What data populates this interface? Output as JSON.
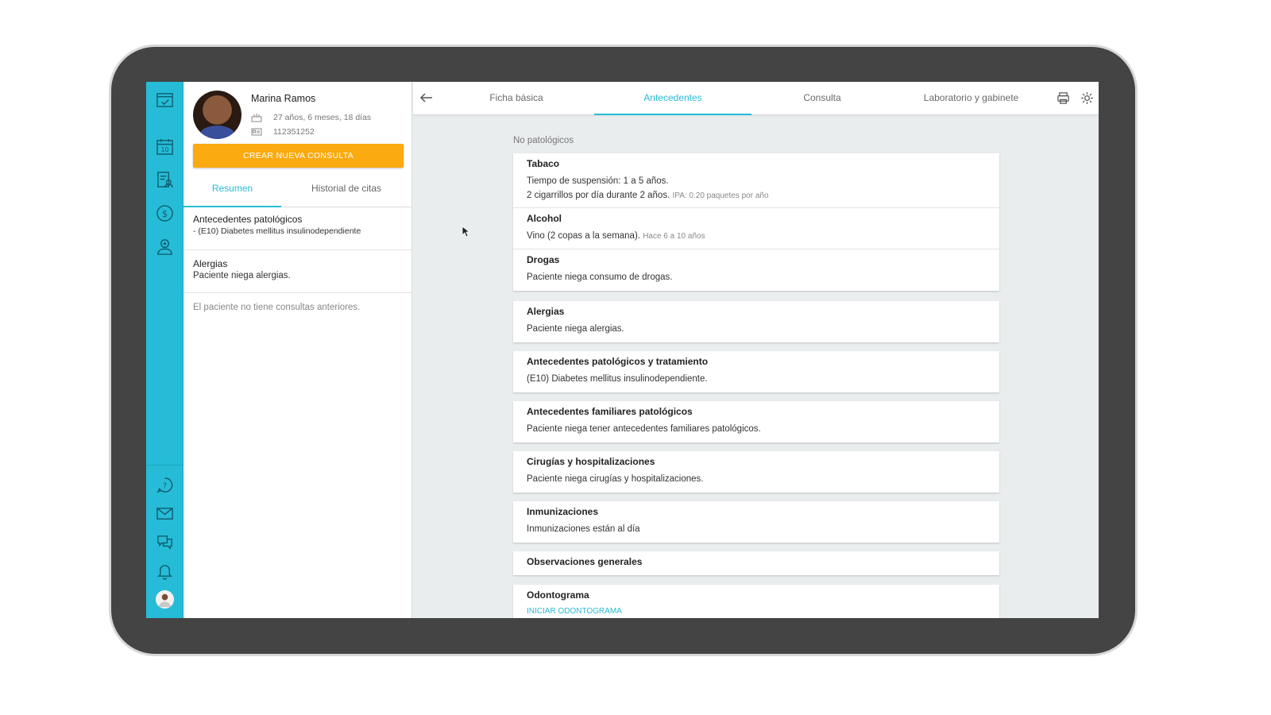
{
  "patient": {
    "name": "Marina Ramos",
    "age": "27 años, 6 meses, 18 días",
    "id_number": "112351252",
    "new_consult_button": "CREAR NUEVA CONSULTA",
    "tabs": [
      {
        "label": "Resumen",
        "active": true
      },
      {
        "label": "Historial de citas",
        "active": false
      }
    ],
    "summary": [
      {
        "title": "Antecedentes patológicos",
        "detail": "- (E10) Diabetes mellitus insulinodependiente"
      },
      {
        "title": "Alergias",
        "detail": "Paciente niega alergias."
      }
    ],
    "no_consults_text": "El paciente no tiene consultas anteriores."
  },
  "rail": {
    "icons": [
      "logo-icon",
      "calendar-icon",
      "records-icon",
      "billing-icon",
      "patient-icon",
      "help-icon",
      "mail-icon",
      "chat-icon",
      "bell-icon",
      "user-avatar"
    ],
    "calendar_day": "10",
    "accent_color": "#26bcd7"
  },
  "topbar": {
    "tabs": [
      {
        "label": "Ficha básica",
        "active": false
      },
      {
        "label": "Antecedentes",
        "active": true
      },
      {
        "label": "Consulta",
        "active": false
      },
      {
        "label": "Laboratorio y gabinete",
        "active": false
      }
    ],
    "icons": [
      "back-arrow-icon",
      "printer-icon",
      "gear-icon"
    ]
  },
  "main": {
    "section_label": "No patológicos",
    "no_patologicos": [
      {
        "title": "Tabaco",
        "lines": [
          "Tiempo de suspensión: 1 a 5 años."
        ],
        "line2": "2 cigarrillos por día durante 2 años.",
        "line2_note": "IPA: 0.20 paquetes por año"
      },
      {
        "title": "Alcohol",
        "line": "Vino (2 copas a la semana).",
        "note": "Hace 6 a 10 años"
      },
      {
        "title": "Drogas",
        "line": "Paciente niega consumo de drogas."
      }
    ],
    "cards": [
      {
        "title": "Alergias",
        "detail": "Paciente niega alergias."
      },
      {
        "title": "Antecedentes patológicos y tratamiento",
        "detail": "(E10) Diabetes mellitus insulinodependiente."
      },
      {
        "title": "Antecedentes familiares patológicos",
        "detail": "Paciente niega tener antecedentes familiares patológicos."
      },
      {
        "title": "Cirugías y hospitalizaciones",
        "detail": "Paciente niega cirugías y hospitalizaciones."
      },
      {
        "title": "Inmunizaciones",
        "detail": "Inmunizaciones están al día"
      },
      {
        "title": "Observaciones generales",
        "detail": ""
      },
      {
        "title": "Odontograma",
        "link": "INICIAR ODONTOGRAMA"
      }
    ]
  }
}
